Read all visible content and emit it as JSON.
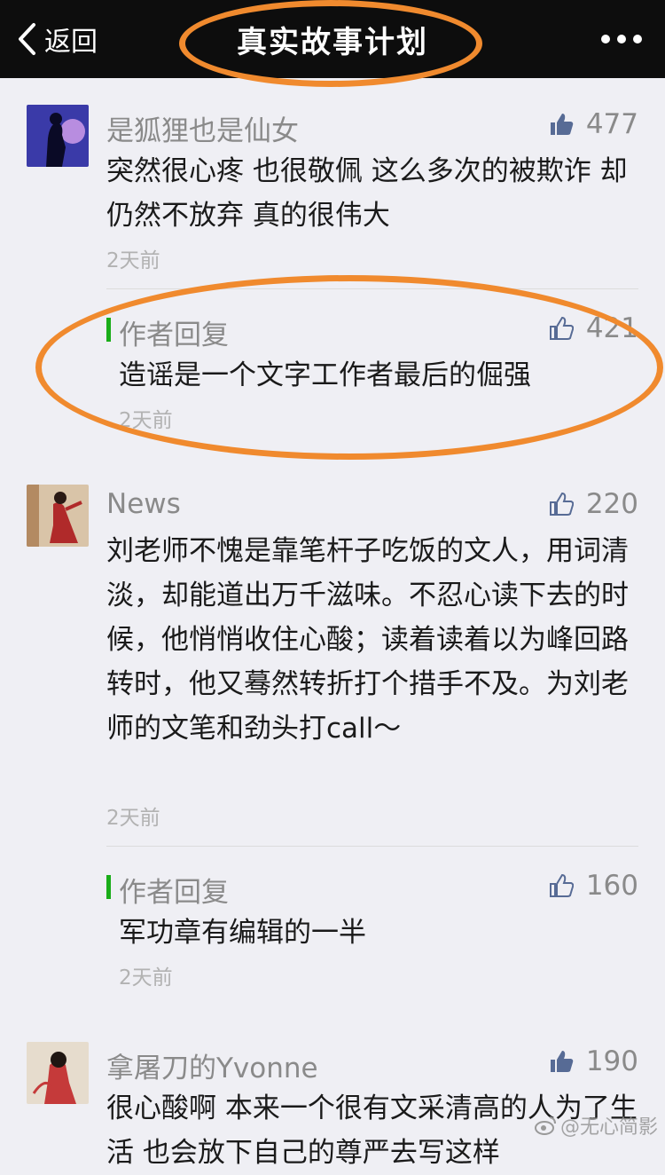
{
  "navbar": {
    "back_label": "返回",
    "title": "真实故事计划",
    "more_icon": "more-dots-icon"
  },
  "comments": [
    {
      "nickname": "是狐狸也是仙女",
      "likes": "477",
      "liked": true,
      "text": "突然很心疼 也很敬佩 这么多次的被欺诈 却仍然不放弃 真的很伟大",
      "time": "2天前",
      "reply": {
        "label": "作者回复",
        "likes": "421",
        "text": "造谣是一个文字工作者最后的倔强",
        "time": "2天前"
      }
    },
    {
      "nickname": "News",
      "likes": "220",
      "liked": false,
      "text": "刘老师不愧是靠笔杆子吃饭的文人，用词清淡，却能道出万千滋味。不忍心读下去的时候，他悄悄收住心酸；读着读着以为峰回路转时，他又蓦然转折打个措手不及。为刘老师的文笔和劲头打call～",
      "time": "2天前",
      "reply": {
        "label": "作者回复",
        "likes": "160",
        "text": "军功章有编辑的一半",
        "time": "2天前"
      }
    },
    {
      "nickname": "拿屠刀的Yvonne",
      "likes": "190",
      "liked": true,
      "text": "很心酸啊  本来一个很有文采清高的人为了生活 也会放下自己的尊严去写这样"
    }
  ],
  "watermark": "@无心简影",
  "colors": {
    "highlight": "#f08a2e",
    "reply_bar": "#1aad19",
    "navbar": "#0d0d0d"
  }
}
